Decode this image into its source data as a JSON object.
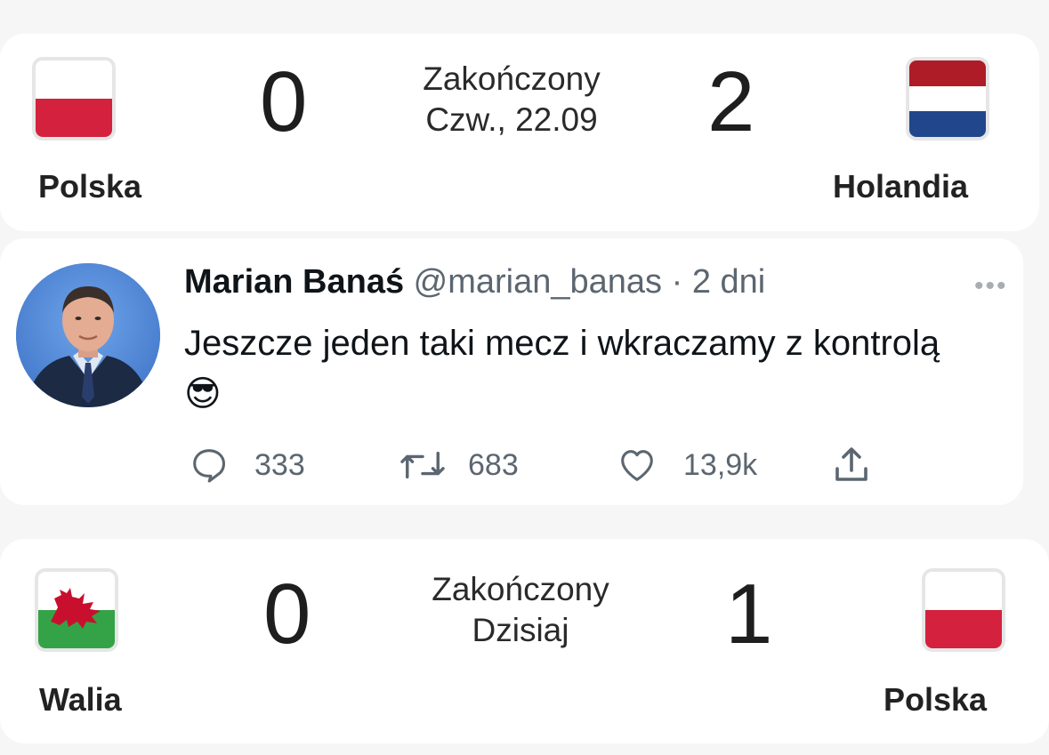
{
  "match1": {
    "home_team": "Polska",
    "away_team": "Holandia",
    "home_score": "0",
    "away_score": "2",
    "status": "Zakończony",
    "date": "Czw., 22.09",
    "home_flag": "poland-flag",
    "away_flag": "netherlands-flag"
  },
  "tweet": {
    "name": "Marian Banaś",
    "handle": "@marian_banas",
    "separator": "·",
    "time": "2 dni",
    "text": "Jeszcze jeden taki mecz i wkraczamy z kontrolą",
    "emoji": "😎",
    "more": "•••",
    "replies": "333",
    "retweets": "683",
    "likes": "13,9k",
    "icons": [
      "reply-icon",
      "retweet-icon",
      "like-icon",
      "share-icon"
    ]
  },
  "match2": {
    "home_team": "Walia",
    "away_team": "Polska",
    "home_score": "0",
    "away_score": "1",
    "status": "Zakończony",
    "date": "Dzisiaj",
    "home_flag": "wales-flag",
    "away_flag": "poland-flag"
  },
  "colors": {
    "poland_red": "#d4213d",
    "netherlands_red": "#ae1c28",
    "netherlands_blue": "#21468b",
    "wales_green": "#34a347",
    "wales_dragon": "#c8102e"
  }
}
